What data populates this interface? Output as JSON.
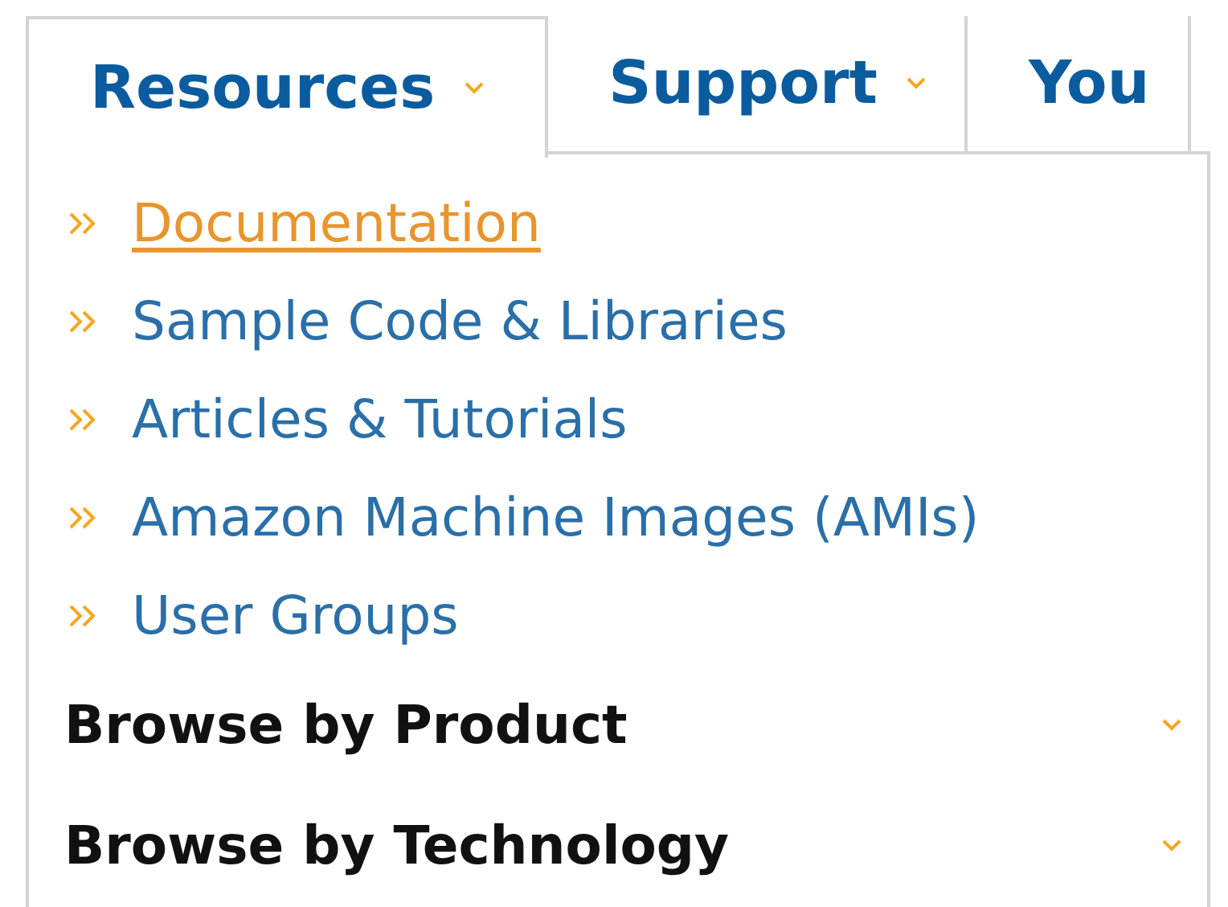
{
  "tabs": [
    {
      "label": "Resources",
      "selected": true,
      "has_menu": true
    },
    {
      "label": "Support",
      "selected": false,
      "has_menu": true
    },
    {
      "label": "You",
      "selected": false,
      "has_menu": false
    }
  ],
  "menu": {
    "links": [
      {
        "label": "Documentation",
        "hovered": true
      },
      {
        "label": "Sample Code & Libraries",
        "hovered": false
      },
      {
        "label": "Articles & Tutorials",
        "hovered": false
      },
      {
        "label": "Amazon Machine Images (AMIs)",
        "hovered": false
      },
      {
        "label": "User Groups",
        "hovered": false
      }
    ],
    "sections": [
      {
        "label": "Browse by Product",
        "expanded": false
      },
      {
        "label": "Browse by Technology",
        "expanded": false
      }
    ]
  }
}
